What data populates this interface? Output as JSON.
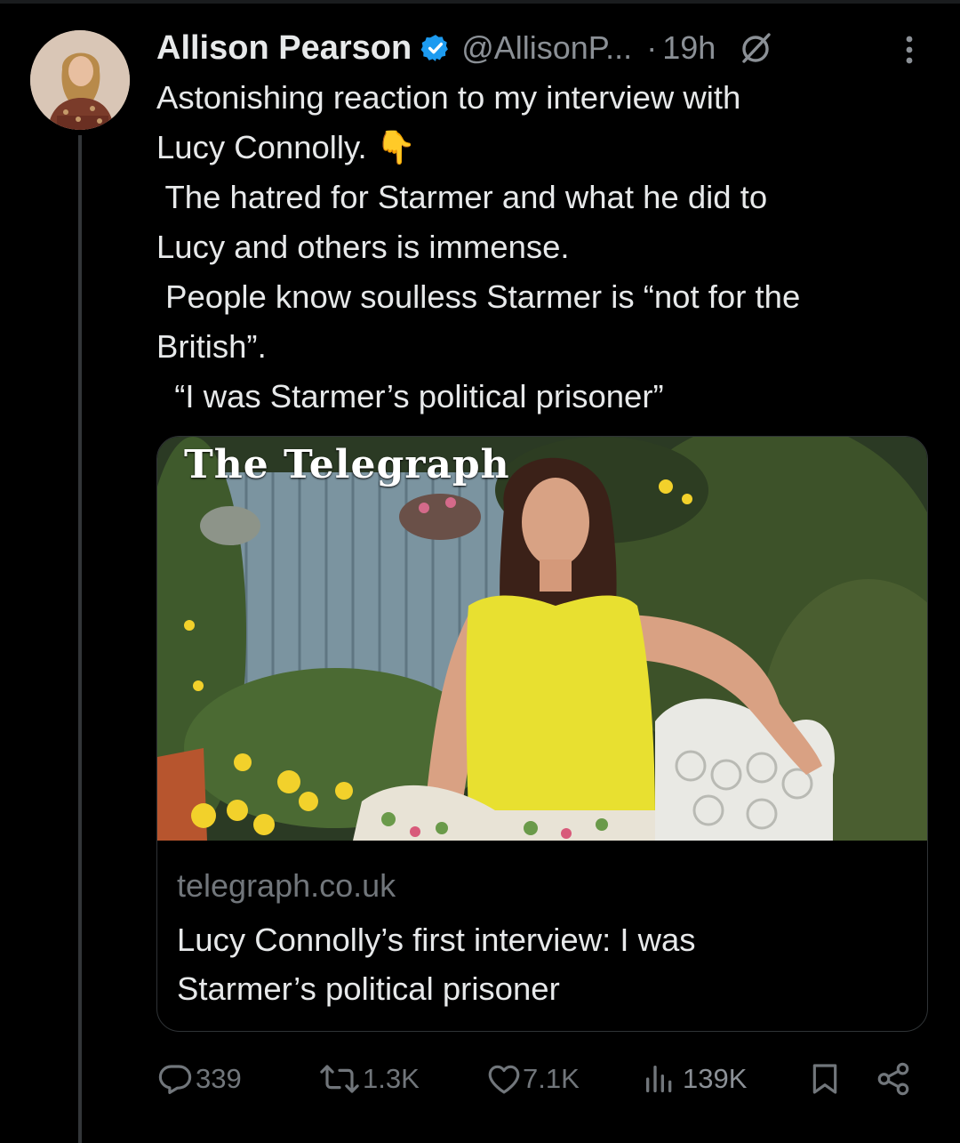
{
  "author": {
    "name": "Allison Pearson",
    "handle": "@AllisonP...",
    "separator": "·",
    "time": "19h"
  },
  "icons": {
    "verified": "verified-badge-icon",
    "grok": "grok-icon",
    "more": "more-options-icon",
    "reply": "reply-icon",
    "retweet": "retweet-icon",
    "like": "like-icon",
    "views": "views-icon",
    "bookmark": "bookmark-icon",
    "share": "share-icon"
  },
  "tweet": {
    "lines": [
      "Astonishing reaction to my interview with",
      "Lucy Connolly. 👇",
      " The hatred for Starmer and what he did to",
      "Lucy and others is immense.",
      " People know soulless Starmer is “not for the",
      "British”.",
      "  “I was Starmer’s political prisoner”"
    ]
  },
  "card": {
    "masthead": "The Telegraph",
    "domain": "telegraph.co.uk",
    "title_line1": "Lucy Connolly’s first interview: I was",
    "title_line2": "Starmer’s political prisoner"
  },
  "stats": {
    "replies": "339",
    "reposts": "1.3K",
    "likes": "7.1K",
    "views": "139K"
  },
  "colors": {
    "background": "#000000",
    "text": "#e7e9ea",
    "muted": "#71767b",
    "verified": "#1d9bf0",
    "border": "#2f3336"
  }
}
